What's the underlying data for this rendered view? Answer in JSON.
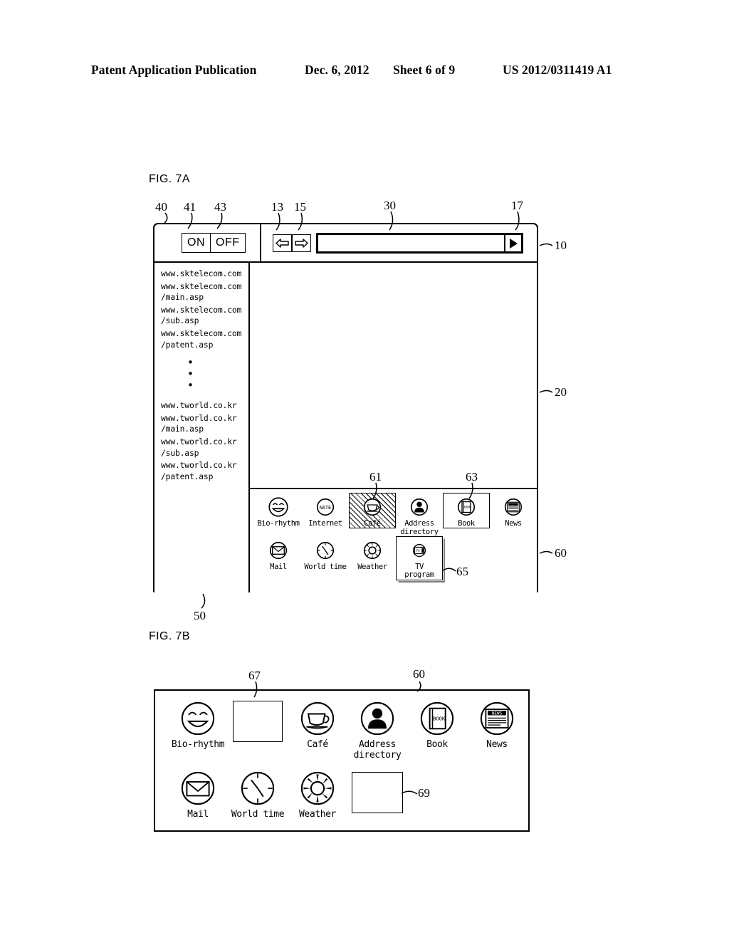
{
  "header": {
    "title": "Patent Application Publication",
    "date": "Dec. 6, 2012",
    "sheet": "Sheet 6 of 9",
    "pub_number": "US 2012/0311419 A1"
  },
  "figures": {
    "fig_a_label": "FIG. 7A",
    "fig_b_label": "FIG. 7B"
  },
  "fig7a": {
    "toolbar": {
      "on_label": "ON",
      "off_label": "OFF",
      "back_icon": "left-arrow-icon",
      "forward_icon": "right-arrow-icon",
      "address_value": "",
      "address_placeholder": "",
      "go_icon": "play-triangle-icon"
    },
    "url_list": {
      "items_top": [
        "www.sktelecom.com",
        "www.sktelecom.com\n/main.asp",
        "www.sktelecom.com\n/sub.asp",
        "www.sktelecom.com\n/patent.asp"
      ],
      "ellipsis": "•",
      "items_bottom": [
        "www.tworld.co.kr",
        "www.tworld.co.kr\n/main.asp",
        "www.tworld.co.kr\n/sub.asp",
        "www.tworld.co.kr\n/patent.asp"
      ]
    },
    "dock": {
      "row1": [
        {
          "label": "Bio-rhythm",
          "icon": "smiley-face-icon",
          "state": "normal"
        },
        {
          "label": "Internet",
          "icon": "nate-circle-icon",
          "state": "normal"
        },
        {
          "label": "Café",
          "icon": "coffee-cup-icon",
          "state": "selected"
        },
        {
          "label": "Address\ndirectory",
          "icon": "person-icon",
          "state": "normal"
        },
        {
          "label": "Book",
          "icon": "book-icon",
          "state": "boxed"
        },
        {
          "label": "News",
          "icon": "newspaper-icon",
          "state": "normal"
        }
      ],
      "row2": [
        {
          "label": "Mail",
          "icon": "envelope-icon",
          "state": "normal"
        },
        {
          "label": "World time",
          "icon": "clock-icon",
          "state": "normal"
        },
        {
          "label": "Weather",
          "icon": "sun-icon",
          "state": "normal"
        },
        {
          "label": "TV\nprogram",
          "icon": "tv-icon",
          "state": "boxed3d"
        }
      ]
    }
  },
  "fig7b": {
    "row1": [
      {
        "label": "Bio-rhythm",
        "icon": "smiley-face-icon",
        "kind": "icon"
      },
      {
        "label": "",
        "icon": "empty-slot",
        "kind": "placeholder"
      },
      {
        "label": "Café",
        "icon": "coffee-cup-icon",
        "kind": "icon"
      },
      {
        "label": "Address\ndirectory",
        "icon": "person-icon",
        "kind": "icon"
      },
      {
        "label": "Book",
        "icon": "book-icon",
        "kind": "icon"
      },
      {
        "label": "News",
        "icon": "newspaper-icon",
        "kind": "icon"
      }
    ],
    "row2": [
      {
        "label": "Mail",
        "icon": "envelope-icon",
        "kind": "icon"
      },
      {
        "label": "World time",
        "icon": "clock-icon",
        "kind": "icon"
      },
      {
        "label": "Weather",
        "icon": "sun-icon",
        "kind": "icon"
      },
      {
        "label": "",
        "icon": "empty-slot",
        "kind": "placeholder"
      }
    ]
  },
  "reference_numerals": {
    "n40": "40",
    "n41": "41",
    "n43": "43",
    "n13": "13",
    "n15": "15",
    "n30": "30",
    "n17": "17",
    "n10": "10",
    "n20": "20",
    "n50": "50",
    "n60a": "60",
    "n61": "61",
    "n63": "63",
    "n65": "65",
    "n67": "67",
    "n69": "69",
    "n60b": "60"
  },
  "icon_glyph_text": {
    "nate": "NATE",
    "book_cover": "BOOK",
    "news_header": "NEWS",
    "tv_screen": "TV"
  }
}
